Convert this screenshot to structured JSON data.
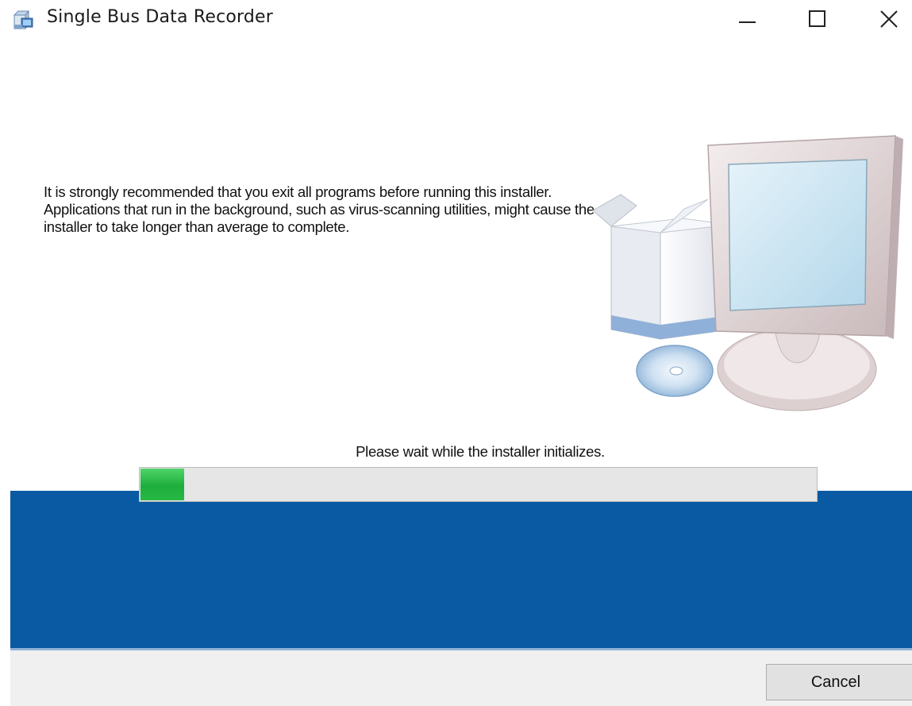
{
  "window": {
    "title": "Single Bus Data Recorder",
    "icon": "installer-box-icon"
  },
  "controls": {
    "minimize_icon": "minimize-icon",
    "maximize_icon": "maximize-icon",
    "close_icon": "close-icon"
  },
  "message": "It is strongly recommended that you exit all programs before running this installer. Applications that run in the background, such as virus-scanning utilities, might cause the installer to take longer than average to complete.",
  "illustration": "computer-setup-icon",
  "status": "Please wait while the installer initializes.",
  "progress": {
    "fraction": 0.065
  },
  "buttons": {
    "cancel": "Cancel"
  },
  "colors": {
    "band": "#0a5aa3",
    "progress_fill": "#22b242",
    "footer": "#f0f0f0"
  }
}
